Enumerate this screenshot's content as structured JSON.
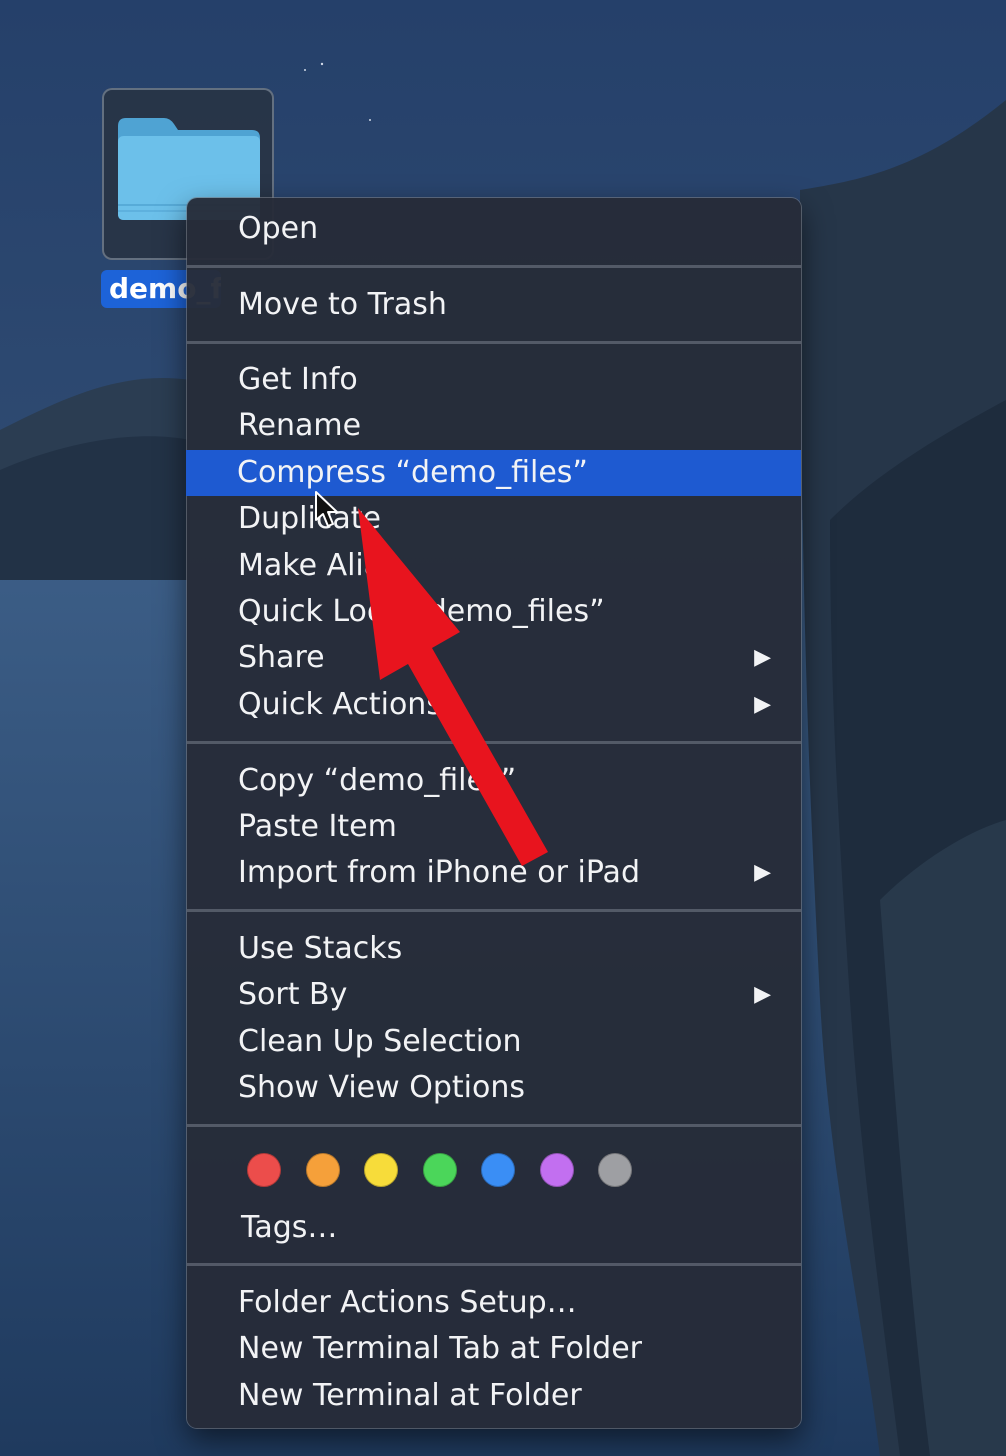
{
  "desktop": {
    "folder_label": "demo_files"
  },
  "context_menu": {
    "groups": [
      [
        {
          "label": "Open"
        }
      ],
      [
        {
          "label": "Move to Trash"
        }
      ],
      [
        {
          "label": "Get Info"
        },
        {
          "label": "Rename"
        },
        {
          "label": "Compress “demo_files”",
          "highlighted": true
        },
        {
          "label": "Duplicate"
        },
        {
          "label": "Make Alias"
        },
        {
          "label": "Quick Look “demo_files”"
        },
        {
          "label": "Share",
          "submenu": true
        },
        {
          "label": "Quick Actions",
          "submenu": true
        }
      ],
      [
        {
          "label": "Copy “demo_files”"
        },
        {
          "label": "Paste Item"
        },
        {
          "label": "Import from iPhone or iPad",
          "submenu": true
        }
      ],
      [
        {
          "label": "Use Stacks"
        },
        {
          "label": "Sort By",
          "submenu": true
        },
        {
          "label": "Clean Up Selection"
        },
        {
          "label": "Show View Options"
        }
      ],
      [
        {
          "label": "Tags…"
        }
      ],
      [
        {
          "label": "Folder Actions Setup…"
        },
        {
          "label": "New Terminal Tab at Folder"
        },
        {
          "label": "New Terminal at Folder"
        }
      ]
    ],
    "submenu_glyph": "▶",
    "tag_colors": [
      {
        "name": "red",
        "hex": "#ec4d4b"
      },
      {
        "name": "orange",
        "hex": "#f5a03a"
      },
      {
        "name": "yellow",
        "hex": "#f7dc3a"
      },
      {
        "name": "green",
        "hex": "#4bd65a"
      },
      {
        "name": "blue",
        "hex": "#3a8ef5"
      },
      {
        "name": "purple",
        "hex": "#c26ff0"
      },
      {
        "name": "gray",
        "hex": "#9e9fa3"
      }
    ],
    "highlight_color": "#1e5ad1"
  },
  "annotation": {
    "arrow_color": "#e8141e",
    "points_to": "Compress “demo_files”"
  }
}
